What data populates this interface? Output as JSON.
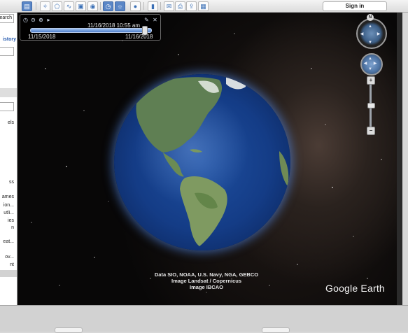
{
  "toolbar": {
    "buttons": [
      {
        "name": "sidebar-toggle-icon",
        "glyph": "▤",
        "active": true
      },
      {
        "name": "placemark-icon",
        "glyph": "✧"
      },
      {
        "name": "polygon-icon",
        "glyph": "⬠"
      },
      {
        "name": "path-icon",
        "glyph": "∿"
      },
      {
        "name": "image-overlay-icon",
        "glyph": "▣"
      },
      {
        "name": "record-tour-icon",
        "glyph": "◉"
      },
      {
        "name": "historical-imagery-icon",
        "glyph": "◷",
        "active": true
      },
      {
        "name": "sunlight-icon",
        "glyph": "☼",
        "active": true
      },
      {
        "name": "planets-icon",
        "glyph": "●"
      },
      {
        "name": "ruler-icon",
        "glyph": "▮"
      },
      {
        "name": "email-icon",
        "glyph": "✉"
      },
      {
        "name": "print-icon",
        "glyph": "⎙"
      },
      {
        "name": "save-image-icon",
        "glyph": "⇪"
      },
      {
        "name": "maps-icon",
        "glyph": "▦"
      }
    ],
    "sign_in_label": "Sign in"
  },
  "sidebar": {
    "search_button": "earch",
    "history_label": "istory",
    "layer_items": [
      "els",
      "ss",
      "ames",
      "ion...",
      "utli...",
      "ies",
      "n",
      "eat...",
      "ov...",
      "nt"
    ]
  },
  "time_slider": {
    "current": "11/16/2018  10:55 am",
    "start": "11/15/2018",
    "end": "11/16/2018",
    "position": 0.95
  },
  "view": {
    "attribution": [
      "Data SIO, NOAA, U.S. Navy, NGA, GEBCO",
      "Image Landsat / Copernicus",
      "Image IBCAO"
    ],
    "logo": "Google Earth"
  },
  "navigation": {
    "north_label": "N",
    "zoom_in": "+",
    "zoom_out": "−"
  }
}
